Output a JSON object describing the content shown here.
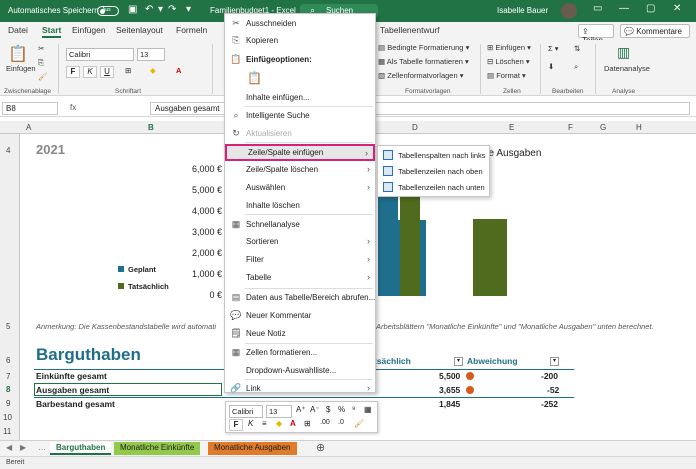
{
  "titlebar": {
    "autosave_label": "Automatisches Speichern",
    "autosave_state": "Aus",
    "filename": "Familienbudget1 - Excel",
    "search_placeholder": "Suchen",
    "user_name": "Isabelle Bauer",
    "color": "#217346"
  },
  "ribbon_tabs": [
    "Datei",
    "Start",
    "Einfügen",
    "Seitenlayout",
    "Formeln",
    "Daten",
    "Überprüfen",
    "Ansicht",
    "Hilfe",
    "Tabellenentwurf"
  ],
  "active_tab": "Start",
  "ribbon_buttons": {
    "share": "Teilen",
    "comments": "Kommentare",
    "paste": "Einfügen",
    "font_name": "Calibri",
    "font_size": "13",
    "bold": "F",
    "italic": "K",
    "underline": "U",
    "conditional_format": "Bedingte Formatierung",
    "format_as_table": "Als Tabelle formatieren",
    "cell_styles": "Zellenformatvorlagen",
    "insert": "Einfügen",
    "delete": "Löschen",
    "format": "Format",
    "data_analysis": "Datenanalyse",
    "group_clipboard": "Zwischenablage",
    "group_font": "Schriftart",
    "group_styles": "Formatvorlagen",
    "group_cells": "Zellen",
    "group_editing": "Bearbeiten",
    "group_analysis": "Analyse"
  },
  "formula_bar": {
    "name_box": "B8",
    "fx": "fx",
    "content": "Ausgaben gesamt"
  },
  "columns": [
    "A",
    "B",
    "C",
    "D",
    "E",
    "F",
    "G",
    "H"
  ],
  "rows": [
    "4",
    "5",
    "6",
    "7",
    "8",
    "9",
    "10",
    "11"
  ],
  "sheet": {
    "year": "2021",
    "chart_title_fragment": "che Ausgaben",
    "note_left": "Anmerkung: Die Kassenbestandstabelle wird automati",
    "note_right": "Arbeitsblättern \"Monatliche Einkünfte\" und \"Monatliche Ausgaben\" unten berechnet.",
    "section_title": "Barguthaben",
    "col_actual_fragment": "tsächlich",
    "col_deviation": "Abweichung",
    "rows": [
      {
        "label": "Einkünfte gesamt",
        "actual": "5,500",
        "dev": "-200"
      },
      {
        "label": "Ausgaben gesamt",
        "actual": "3,655",
        "dev": "-52"
      },
      {
        "label": "Barbestand gesamt",
        "actual": "1,845",
        "dev": "-252"
      }
    ]
  },
  "chart_data": {
    "type": "bar",
    "title": "che Ausgaben",
    "categories": [
      "Ausgaben"
    ],
    "series": [
      {
        "name": "Geplant",
        "values": [
          3600
        ],
        "color": "#1f6e8c"
      },
      {
        "name": "Tatsächlich",
        "values": [
          3655
        ],
        "color": "#4e6b1e"
      }
    ],
    "y_ticks": [
      "6,000 €",
      "5,000 €",
      "4,000 €",
      "3,000 €",
      "2,000 €",
      "1,000 €",
      "0 €"
    ],
    "ylim": [
      0,
      6000
    ],
    "legend_position": "left"
  },
  "context_menu": {
    "items": [
      {
        "label": "Ausschneiden",
        "icon": "scissors-icon",
        "glyph": "✂"
      },
      {
        "label": "Kopieren",
        "icon": "copy-icon",
        "glyph": "⎘"
      },
      {
        "label": "Einfügeoptionen:",
        "icon": "paste-options-icon",
        "glyph": "📋"
      },
      {
        "label": "Inhalte einfügen...",
        "icon": "",
        "glyph": ""
      },
      {
        "label": "Intelligente Suche",
        "icon": "search-icon",
        "glyph": "⌕"
      },
      {
        "label": "Aktualisieren",
        "icon": "refresh-icon",
        "glyph": "↻"
      },
      {
        "label": "Zeile/Spalte einfügen",
        "icon": "",
        "glyph": ""
      },
      {
        "label": "Zeile/Spalte löschen",
        "icon": "",
        "glyph": ""
      },
      {
        "label": "Auswählen",
        "icon": "",
        "glyph": ""
      },
      {
        "label": "Inhalte löschen",
        "icon": "",
        "glyph": ""
      },
      {
        "label": "Schnellanalyse",
        "icon": "quick-analysis-icon",
        "glyph": "▦"
      },
      {
        "label": "Sortieren",
        "icon": "",
        "glyph": ""
      },
      {
        "label": "Filter",
        "icon": "",
        "glyph": ""
      },
      {
        "label": "Tabelle",
        "icon": "",
        "glyph": ""
      },
      {
        "label": "Daten aus Tabelle/Bereich abrufen...",
        "icon": "table-data-icon",
        "glyph": "▤"
      },
      {
        "label": "Neuer Kommentar",
        "icon": "comment-icon",
        "glyph": "💬"
      },
      {
        "label": "Neue Notiz",
        "icon": "note-icon",
        "glyph": "🗒"
      },
      {
        "label": "Zellen formatieren...",
        "icon": "format-cells-icon",
        "glyph": "▦"
      },
      {
        "label": "Dropdown-Auswahlliste...",
        "icon": "",
        "glyph": ""
      },
      {
        "label": "Link",
        "icon": "link-icon",
        "glyph": "🔗"
      }
    ]
  },
  "submenu": {
    "items": [
      "Tabellenspalten nach links",
      "Tabellenzeilen nach oben",
      "Tabellenzeilen nach unten"
    ]
  },
  "mini_toolbar": {
    "font": "Calibri",
    "size": "13"
  },
  "sheet_tabs": [
    "Barguthaben",
    "Monatliche Einkünfte",
    "Monatliche Ausgaben"
  ],
  "status": {
    "left": "Bereit"
  }
}
